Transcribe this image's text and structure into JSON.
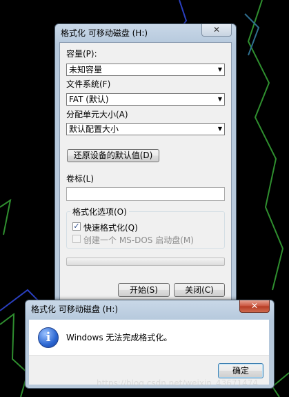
{
  "format_dialog": {
    "title": "格式化 可移动磁盘 (H:)",
    "close_glyph": "✕",
    "capacity_label": "容量(P):",
    "capacity_value": "未知容量",
    "filesystem_label": "文件系统(F)",
    "filesystem_value": "FAT (默认)",
    "allocation_label": "分配单元大小(A)",
    "allocation_value": "默认配置大小",
    "restore_defaults_label": "还原设备的默认值(D)",
    "volume_label_label": "卷标(L)",
    "volume_label_value": "",
    "options_group_title": "格式化选项(O)",
    "quick_format_label": "快速格式化(Q)",
    "quick_format_checked": true,
    "msdos_label": "创建一个 MS-DOS 启动盘(M)",
    "msdos_checked": false,
    "progress": 0,
    "start_label": "开始(S)",
    "close_label": "关闭(C)"
  },
  "message_box": {
    "title": "格式化 可移动磁盘 (H:)",
    "close_glyph": "✕",
    "icon": "info-icon",
    "icon_glyph": "i",
    "message": "Windows 无法完成格式化。",
    "ok_label": "确定"
  },
  "watermark": "https://blog.csdn.net/weixin_43671474",
  "colors": {
    "desktop": "#000000",
    "desktop_lines": "#2f8f2f",
    "desktop_lines2": "#2a3fbf",
    "close_red": "#c9523b"
  }
}
